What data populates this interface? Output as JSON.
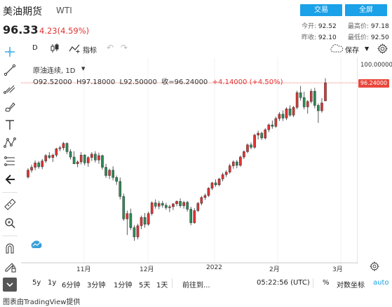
{
  "header": {
    "title": "美油期货",
    "symbol": "WTI",
    "trade_button": "交易",
    "fullscreen_button": "全屏",
    "price": "96.33",
    "change": "4.23(4.59%)",
    "stats": {
      "open_label": "今开:",
      "open": "92.52",
      "high_label": "最高价:",
      "high": "97.18",
      "prev_close_label": "昨收:",
      "prev_close": "92.10",
      "low_label": "最低价:",
      "low": "92.50"
    }
  },
  "toolbar": {
    "interval": "D",
    "indicators": "指标",
    "save": "保存"
  },
  "legend": {
    "title": "原油连续, 1D",
    "open": "O92.52000",
    "high": "H97.18000",
    "low": "L92.50000",
    "close": "收=96.24000",
    "change": "+4.14000 (+4.50%)"
  },
  "price_scale": {
    "top_tick": "100.00000",
    "last_price_tag": "96.24000"
  },
  "time_axis": {
    "labels": [
      "11月",
      "12月",
      "2022",
      "2月",
      "3月"
    ]
  },
  "bottom_bar": {
    "ranges": [
      "5y",
      "1y",
      "6分钟",
      "3分钟",
      "1分钟",
      "5天",
      "1天"
    ],
    "goto": "前往到...",
    "time": "05:22:56 (UTC)",
    "percent": "%",
    "log": "对数坐标",
    "auto": "auto"
  },
  "credit": "图表由TradingView提供",
  "colors": {
    "up": "#e23333",
    "down": "#2e8b57",
    "accent": "#1aa1e8",
    "price_line": "#e8483c",
    "text_gray": "#666666"
  },
  "chart_data": {
    "type": "candlestick",
    "title": "原油连续, 1D",
    "ylim": [
      60,
      100
    ],
    "x_labels": [
      "11月",
      "12月",
      "2022",
      "2月",
      "3月"
    ],
    "candles": [
      [
        76.9,
        78.7,
        76.6,
        78.3
      ],
      [
        78.3,
        79.4,
        77.8,
        78.9
      ],
      [
        78.9,
        80.3,
        78.3,
        79.8
      ],
      [
        79.8,
        80.2,
        78.6,
        79.0
      ],
      [
        79.0,
        80.6,
        78.5,
        80.2
      ],
      [
        80.2,
        81.6,
        79.8,
        81.3
      ],
      [
        81.3,
        82.0,
        80.6,
        80.9
      ],
      [
        80.9,
        81.7,
        80.0,
        81.4
      ],
      [
        81.4,
        82.9,
        81.0,
        82.7
      ],
      [
        82.7,
        83.3,
        82.2,
        82.9
      ],
      [
        82.9,
        84.1,
        82.4,
        83.8
      ],
      [
        83.8,
        84.0,
        81.6,
        82.1
      ],
      [
        82.1,
        82.6,
        80.5,
        81.0
      ],
      [
        81.0,
        82.2,
        80.0,
        79.6
      ],
      [
        79.6,
        80.3,
        78.9,
        80.0
      ],
      [
        80.0,
        82.0,
        79.5,
        81.4
      ],
      [
        81.4,
        81.6,
        79.3,
        79.8
      ],
      [
        79.8,
        81.2,
        79.0,
        80.9
      ],
      [
        80.9,
        82.0,
        80.2,
        81.6
      ],
      [
        81.6,
        82.2,
        79.9,
        80.4
      ],
      [
        80.4,
        81.9,
        79.6,
        81.3
      ],
      [
        81.3,
        81.5,
        78.4,
        78.9
      ],
      [
        78.9,
        79.6,
        76.7,
        77.2
      ],
      [
        77.2,
        78.6,
        76.5,
        78.3
      ],
      [
        78.3,
        79.1,
        76.2,
        76.8
      ],
      [
        76.8,
        77.2,
        75.3,
        76.0
      ],
      [
        76.0,
        76.8,
        72.3,
        72.9
      ],
      [
        72.9,
        73.5,
        67.9,
        68.3
      ],
      [
        68.3,
        70.0,
        65.0,
        69.4
      ],
      [
        69.4,
        70.4,
        66.0,
        66.5
      ],
      [
        66.5,
        67.0,
        63.8,
        64.6
      ],
      [
        64.6,
        67.3,
        64.1,
        66.9
      ],
      [
        66.9,
        69.0,
        66.2,
        68.6
      ],
      [
        68.6,
        69.5,
        66.5,
        67.2
      ],
      [
        67.2,
        69.8,
        66.9,
        69.4
      ],
      [
        69.4,
        71.9,
        69.0,
        71.6
      ],
      [
        71.6,
        72.3,
        70.4,
        70.9
      ],
      [
        70.9,
        72.0,
        70.3,
        71.5
      ],
      [
        71.5,
        72.0,
        70.6,
        71.1
      ],
      [
        71.1,
        71.6,
        70.2,
        70.6
      ],
      [
        70.6,
        71.2,
        69.7,
        70.8
      ],
      [
        70.8,
        71.5,
        70.1,
        71.4
      ],
      [
        71.4,
        72.1,
        70.9,
        71.9
      ],
      [
        71.9,
        72.5,
        70.6,
        71.0
      ],
      [
        71.0,
        72.0,
        70.4,
        71.7
      ],
      [
        71.7,
        72.0,
        69.8,
        70.3
      ],
      [
        70.3,
        70.8,
        67.0,
        67.5
      ],
      [
        67.5,
        70.5,
        67.3,
        70.0
      ],
      [
        70.0,
        71.8,
        69.7,
        71.5
      ],
      [
        71.5,
        73.0,
        71.1,
        72.7
      ],
      [
        72.7,
        73.5,
        72.2,
        73.1
      ],
      [
        73.1,
        74.8,
        72.8,
        74.6
      ],
      [
        74.6,
        75.9,
        74.2,
        75.7
      ],
      [
        75.7,
        76.4,
        74.9,
        75.3
      ],
      [
        75.3,
        76.7,
        75.0,
        76.5
      ],
      [
        76.5,
        77.8,
        76.0,
        77.4
      ],
      [
        77.4,
        78.3,
        76.9,
        77.9
      ],
      [
        77.9,
        79.6,
        77.6,
        79.2
      ],
      [
        79.2,
        80.3,
        78.6,
        80.0
      ],
      [
        80.0,
        80.4,
        78.7,
        79.3
      ],
      [
        79.3,
        81.3,
        79.0,
        81.0
      ],
      [
        81.0,
        82.4,
        80.6,
        82.1
      ],
      [
        82.1,
        83.8,
        81.8,
        83.5
      ],
      [
        83.5,
        84.0,
        82.6,
        83.0
      ],
      [
        83.0,
        85.8,
        82.7,
        85.5
      ],
      [
        85.5,
        86.4,
        84.6,
        85.9
      ],
      [
        85.9,
        86.2,
        84.5,
        84.9
      ],
      [
        84.9,
        86.9,
        84.6,
        86.6
      ],
      [
        86.6,
        87.9,
        86.1,
        87.6
      ],
      [
        87.6,
        88.5,
        86.8,
        87.3
      ],
      [
        87.3,
        89.3,
        87.0,
        88.9
      ],
      [
        88.9,
        90.2,
        88.4,
        89.8
      ],
      [
        89.8,
        90.6,
        88.4,
        89.0
      ],
      [
        89.0,
        91.2,
        88.6,
        90.9
      ],
      [
        90.9,
        91.6,
        89.3,
        89.6
      ],
      [
        89.6,
        91.5,
        89.2,
        91.2
      ],
      [
        91.2,
        94.6,
        90.8,
        94.2
      ],
      [
        94.2,
        95.6,
        92.6,
        93.2
      ],
      [
        93.2,
        94.4,
        90.8,
        91.3
      ],
      [
        91.3,
        92.7,
        89.9,
        92.4
      ],
      [
        92.4,
        95.0,
        92.0,
        94.5
      ],
      [
        94.5,
        95.2,
        91.0,
        91.6
      ],
      [
        91.6,
        92.0,
        88.0,
        90.5
      ],
      [
        90.5,
        93.1,
        90.1,
        92.1
      ],
      [
        92.52,
        97.18,
        92.5,
        96.24
      ]
    ]
  }
}
